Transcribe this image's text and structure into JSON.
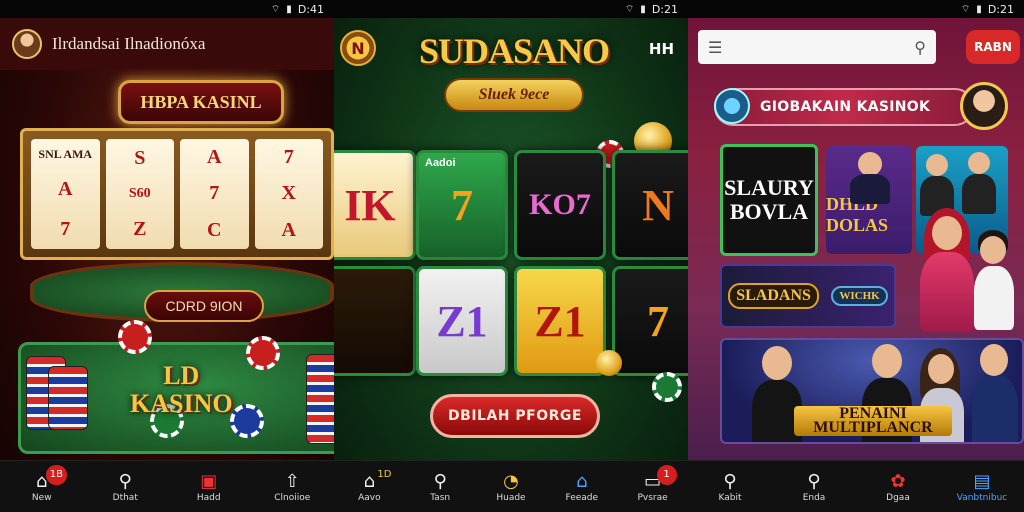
{
  "panel1": {
    "status_time": "D:41",
    "app_title": "Ilrdandsai Ilnadionóxa",
    "marquee": "HBPA KASINL",
    "reels": [
      [
        "SNL AMA",
        "A",
        "7"
      ],
      [
        "S",
        "S60",
        "Z"
      ],
      [
        "A",
        "7",
        "C"
      ],
      [
        "7",
        "X",
        "A"
      ]
    ],
    "pill_label": "CDRD 9ION",
    "logo_lines": [
      "LD",
      "KASINO"
    ],
    "nav": [
      {
        "label": "New",
        "icon": "home-icon",
        "badge": "1B"
      },
      {
        "label": "Dthat",
        "icon": "search-icon"
      },
      {
        "label": "Hadd",
        "icon": "slots-icon"
      },
      {
        "label": "Clnoiioe",
        "icon": "upload-icon"
      }
    ]
  },
  "panel2": {
    "status_time": "D:21",
    "logo_mark": "N",
    "title": "SUDASANO",
    "subtitle": "Sluek 9ece",
    "corner_text": "HH",
    "tiles": [
      "IK",
      "7",
      "KO7",
      "N",
      "",
      "Z1",
      "Z1",
      "7"
    ],
    "tile_tag": "Aadoi",
    "cta": "DBILAH PFORGE",
    "nav": [
      {
        "label": "Aavo",
        "icon": "home-icon",
        "badge": "1D"
      },
      {
        "label": "Tasn",
        "icon": "search-icon"
      },
      {
        "label": "Huade",
        "icon": "clock-icon"
      },
      {
        "label": "Feeade",
        "icon": "house-icon"
      },
      {
        "label": "Pvsrae",
        "icon": "inbox-icon",
        "badge": "1"
      }
    ]
  },
  "panel3": {
    "status_time": "D:21",
    "search_placeholder": "",
    "button_label": "RABN",
    "banner": "GIOBAKAIN KASINOK",
    "cards": {
      "dark_card": "SLAURY BOVLA",
      "purple_card": "DHLD DOLAS",
      "strip_left": "SLADANS",
      "strip_right": "WICHK",
      "multi_label": "PENAINI MULTIPLANCR"
    },
    "nav": [
      {
        "label": "Kabit",
        "icon": "search-icon"
      },
      {
        "label": "Enda",
        "icon": "search-icon"
      },
      {
        "label": "Dgaa",
        "icon": "chip-icon"
      },
      {
        "label": "Vanbtnibuc",
        "icon": "document-icon",
        "active": true
      }
    ],
    "accent_color": "#4fa3ff"
  }
}
